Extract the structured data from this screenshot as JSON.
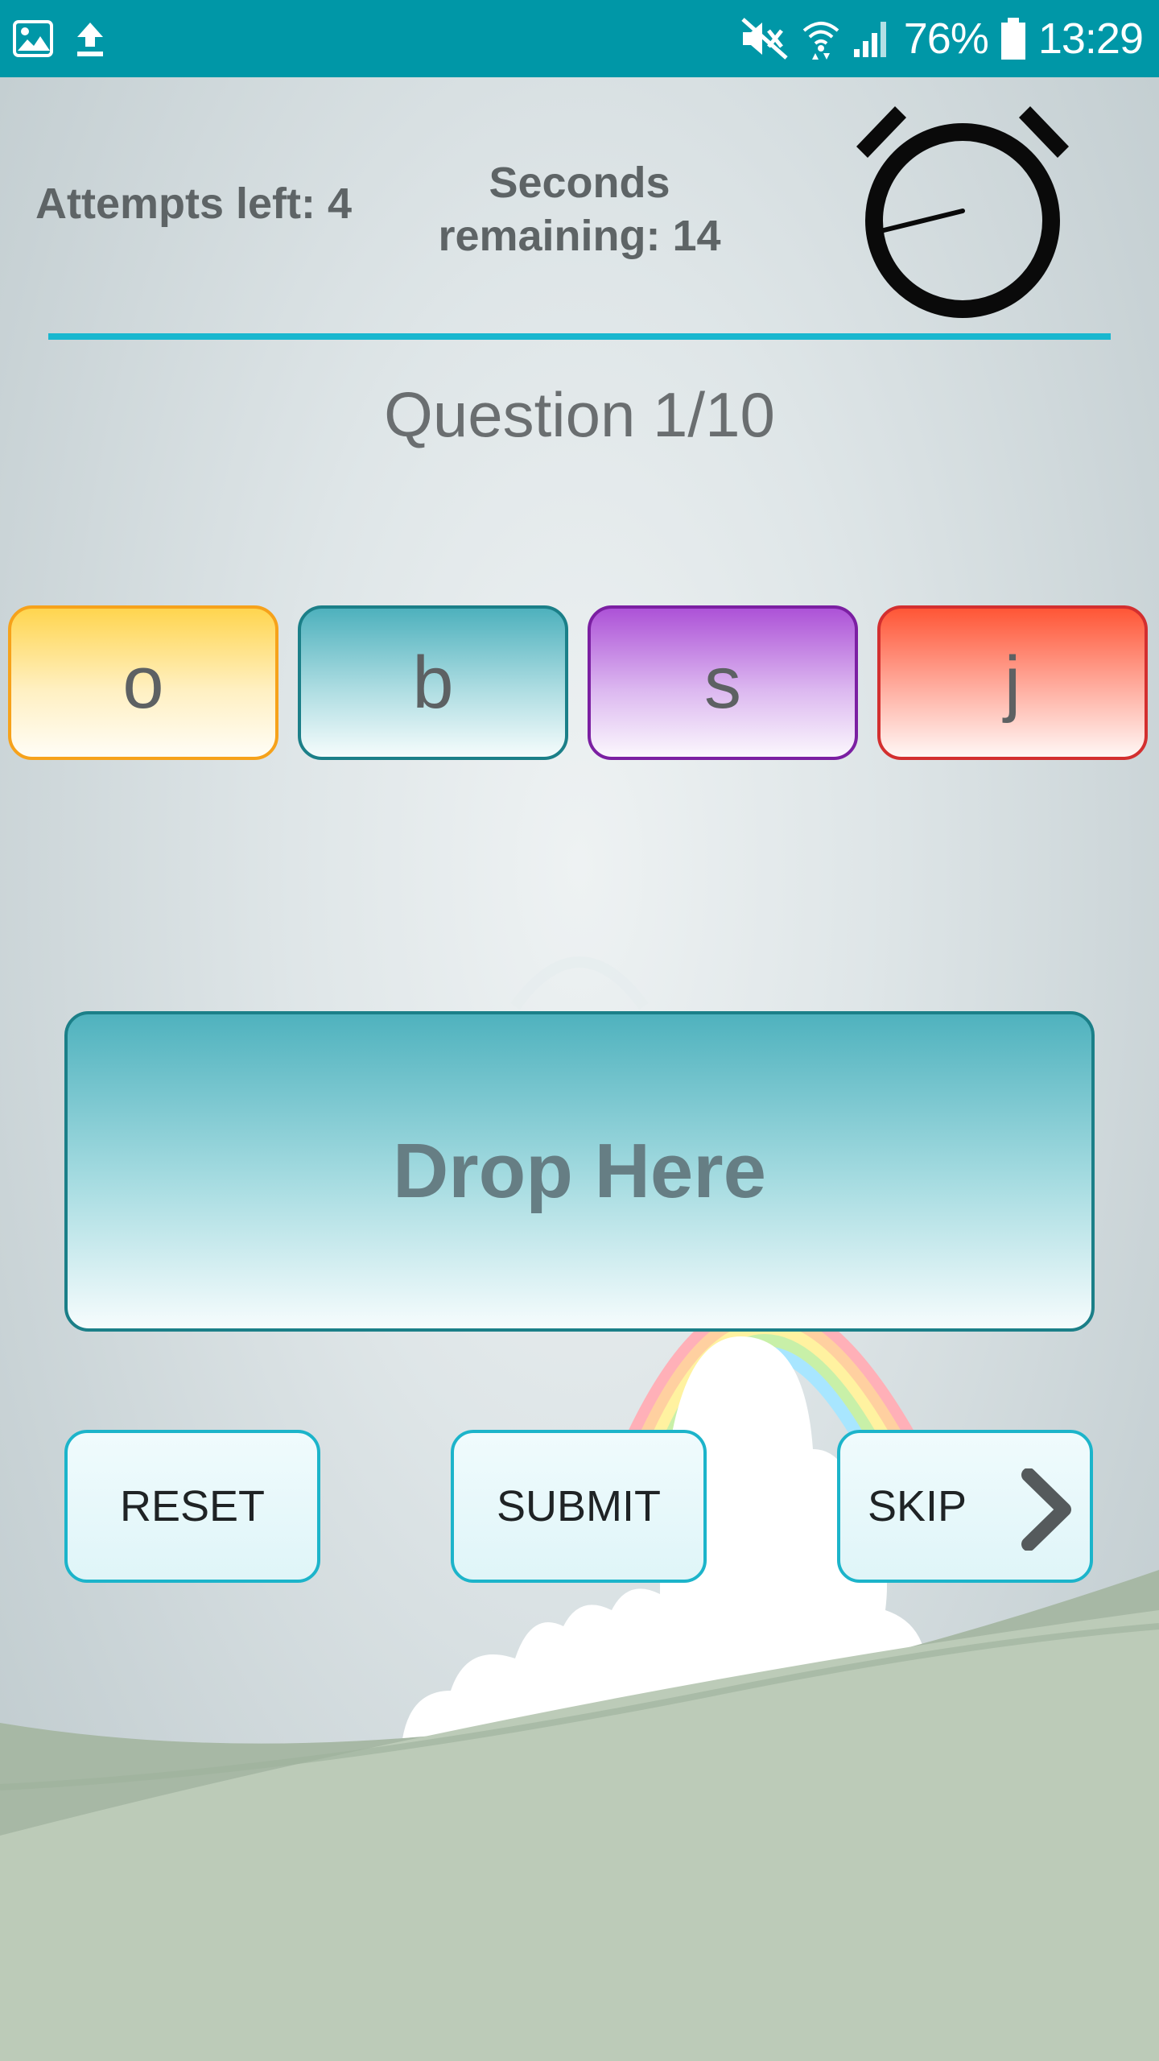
{
  "status_bar": {
    "icons_left": [
      "image-icon",
      "upload-icon"
    ],
    "icons_right": [
      "mute-icon",
      "wifi-icon",
      "signal-icon"
    ],
    "battery_percent": "76%",
    "time": "13:29"
  },
  "header": {
    "attempts": "Attempts left: 4",
    "seconds_label": "Seconds",
    "seconds_value": "remaining: 14",
    "timer_icon": "stopwatch-icon"
  },
  "question": "Question 1/10",
  "tiles": [
    {
      "letter": "o",
      "color": "#ffd54f"
    },
    {
      "letter": "b",
      "color": "#4eb1bd"
    },
    {
      "letter": "s",
      "color": "#ad52d7"
    },
    {
      "letter": "j",
      "color": "#ff5636"
    }
  ],
  "drop_zone": {
    "label": "Drop Here"
  },
  "buttons": {
    "reset": "RESET",
    "submit": "SUBMIT",
    "skip": "SKIP"
  },
  "colors": {
    "status_bar": "#0097a7",
    "divider": "#19b7cf",
    "button_border": "#1cb4ca"
  }
}
